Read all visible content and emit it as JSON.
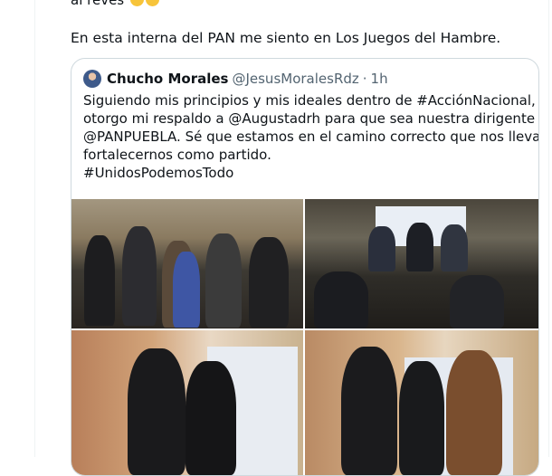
{
  "tweet": {
    "top_text_fragment": "al revés",
    "text": "En esta interna del PAN me siento en Los Juegos del Hambre."
  },
  "quoted_tweet": {
    "author_name": "Chucho Morales",
    "author_handle": "@JesusMoralesRdz",
    "separator": "·",
    "time": "1h",
    "lines": [
      "Siguiendo mis principios y mis ideales dentro de #AcciónNacional,",
      "otorgo mi respaldo a @Augustadrh para que sea nuestra dirigente en el",
      "@PANPUEBLA. Sé que estamos en el camino correcto que nos llevará a",
      "fortalecernos como partido.",
      "#UnidosPodemosTodo"
    ],
    "media": [
      {
        "name": "photo-rally-crowd"
      },
      {
        "name": "photo-event-audience"
      },
      {
        "name": "photo-pair-portrait-1"
      },
      {
        "name": "photo-pair-portrait-2"
      }
    ]
  },
  "colors": {
    "text": "#0f1419",
    "secondary": "#536471",
    "border": "#cfd9de"
  }
}
